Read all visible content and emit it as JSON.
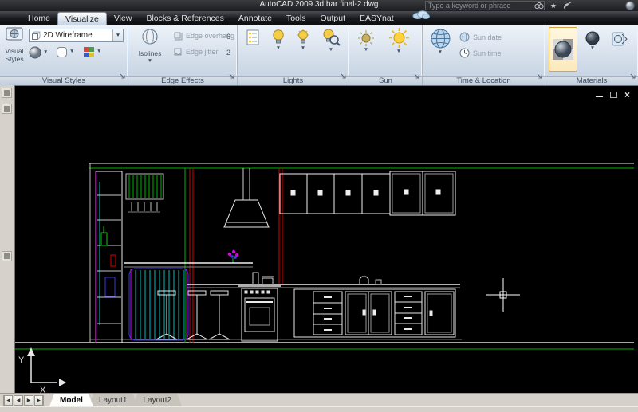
{
  "palette": {
    "canvas_bg": "#000000",
    "line_white": "#efefef",
    "line_green": "#00b400",
    "line_red": "#d40000",
    "line_magenta": "#e000e0",
    "line_cyan": "#00c0c0",
    "line_blue": "#3a3ae0",
    "ribbon_bg": "#cfdae7",
    "tabbar_bg": "#17191d",
    "materials_highlight": "#e0a23c"
  },
  "titlebar": {
    "title": "AutoCAD 2009 3d bar final-2.dwg",
    "search_placeholder": "Type a keyword or phrase"
  },
  "tabs": [
    {
      "label": "Home",
      "active": false
    },
    {
      "label": "Visualize",
      "active": true
    },
    {
      "label": "View",
      "active": false
    },
    {
      "label": "Blocks & References",
      "active": false
    },
    {
      "label": "Annotate",
      "active": false
    },
    {
      "label": "Tools",
      "active": false
    },
    {
      "label": "Output",
      "active": false
    },
    {
      "label": "EASYnat",
      "active": false
    }
  ],
  "ribbon": {
    "visual_styles": {
      "panel_label": "Visual Styles",
      "big_button_label": "Visual Styles",
      "style_dropdown_value": "2D Wireframe"
    },
    "edge_effects": {
      "panel_label": "Edge Effects",
      "isolines_label": "Isolines",
      "overhang_label": "Edge overhang",
      "overhang_value": "6",
      "jitter_label": "Edge jitter",
      "jitter_value": "2"
    },
    "lights": {
      "panel_label": "Lights"
    },
    "sun": {
      "panel_label": "Sun"
    },
    "time_location": {
      "panel_label": "Time & Location",
      "sun_date_label": "Sun date",
      "sun_time_label": "Sun time"
    },
    "materials": {
      "panel_label": "Materials"
    }
  },
  "canvas": {
    "window_controls": {
      "close_glyph": "×"
    },
    "ucs": {
      "x_label": "X",
      "y_label": "Y"
    }
  },
  "layout_tabs": [
    {
      "label": "Model",
      "active": true
    },
    {
      "label": "Layout1",
      "active": false
    },
    {
      "label": "Layout2",
      "active": false
    }
  ]
}
